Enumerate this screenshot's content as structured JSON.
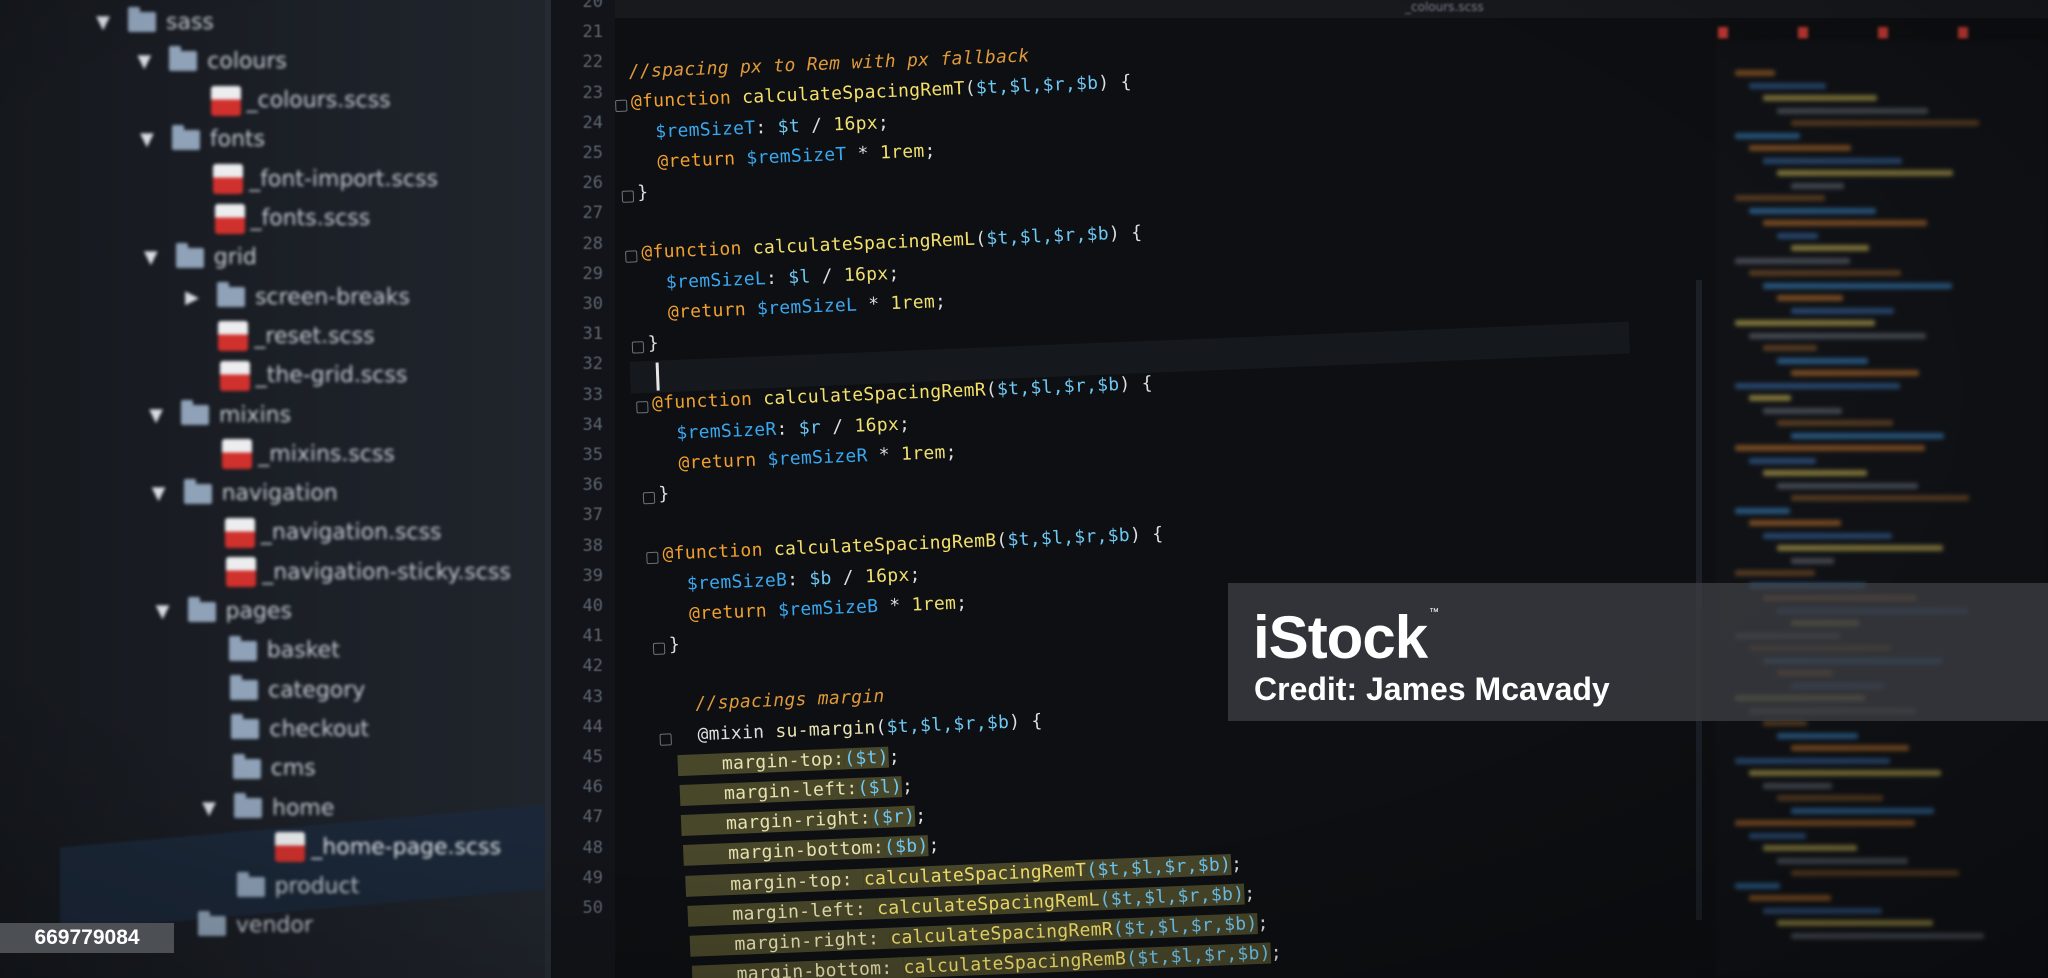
{
  "sidebar": {
    "tree": [
      {
        "kind": "folder",
        "label": "sass",
        "state": "open",
        "depth": 0
      },
      {
        "kind": "folder",
        "label": "colours",
        "state": "open",
        "depth": 1
      },
      {
        "kind": "file",
        "label": "_colours.scss",
        "depth": 2
      },
      {
        "kind": "folder",
        "label": "fonts",
        "state": "open",
        "depth": 1
      },
      {
        "kind": "file",
        "label": "_font-import.scss",
        "depth": 2
      },
      {
        "kind": "file",
        "label": "_fonts.scss",
        "depth": 2
      },
      {
        "kind": "folder",
        "label": "grid",
        "state": "open",
        "depth": 1
      },
      {
        "kind": "folder",
        "label": "screen-breaks",
        "state": "closed",
        "depth": 2
      },
      {
        "kind": "file",
        "label": "_reset.scss",
        "depth": 2
      },
      {
        "kind": "file",
        "label": "_the-grid.scss",
        "depth": 2
      },
      {
        "kind": "folder",
        "label": "mixins",
        "state": "open",
        "depth": 1
      },
      {
        "kind": "file",
        "label": "_mixins.scss",
        "depth": 2
      },
      {
        "kind": "folder",
        "label": "navigation",
        "state": "open",
        "depth": 1
      },
      {
        "kind": "file",
        "label": "_navigation.scss",
        "depth": 2
      },
      {
        "kind": "file",
        "label": "_navigation-sticky.scss",
        "depth": 2
      },
      {
        "kind": "folder",
        "label": "pages",
        "state": "open",
        "depth": 1
      },
      {
        "kind": "folder",
        "label": "basket",
        "state": "none",
        "depth": 2
      },
      {
        "kind": "folder",
        "label": "category",
        "state": "none",
        "depth": 2
      },
      {
        "kind": "folder",
        "label": "checkout",
        "state": "none",
        "depth": 2
      },
      {
        "kind": "folder",
        "label": "cms",
        "state": "none",
        "depth": 2
      },
      {
        "kind": "folder",
        "label": "home",
        "state": "open",
        "depth": 2
      },
      {
        "kind": "file",
        "label": "_home-page.scss",
        "depth": 3,
        "selected": true
      },
      {
        "kind": "folder",
        "label": "product",
        "state": "none",
        "depth": 2
      },
      {
        "kind": "folder",
        "label": "vendor",
        "state": "none",
        "depth": 1
      }
    ]
  },
  "tabs": {
    "active": "_colours.scss"
  },
  "gutter": {
    "line_numbers": [
      "20",
      "21",
      "22",
      "23",
      "24",
      "25",
      "26",
      "27",
      "28",
      "29",
      "30",
      "31",
      "32",
      "33",
      "34",
      "35",
      "36",
      "37",
      "38",
      "39",
      "40",
      "41",
      "42",
      "43",
      "44",
      "45",
      "46",
      "47",
      "48",
      "49",
      "50"
    ]
  },
  "code": {
    "lines": [
      [],
      [
        {
          "t": "//spacing px to Rem with px fallback",
          "c": "c-comment"
        }
      ],
      [
        {
          "t": "@function ",
          "c": "c-at"
        },
        {
          "t": "calculateSpacingRemT",
          "c": "c-fn"
        },
        {
          "t": "(",
          "c": "c-plain"
        },
        {
          "t": "$t,$l,$r,$b",
          "c": "c-arg"
        },
        {
          "t": ") {",
          "c": "c-plain"
        }
      ],
      [
        {
          "t": "  $remSizeT",
          "c": "c-var"
        },
        {
          "t": ": ",
          "c": "c-plain"
        },
        {
          "t": "$t",
          "c": "c-arg"
        },
        {
          "t": " / ",
          "c": "c-plain"
        },
        {
          "t": "16px",
          "c": "c-num"
        },
        {
          "t": ";",
          "c": "c-plain"
        }
      ],
      [
        {
          "t": "  @return ",
          "c": "c-at"
        },
        {
          "t": "$remSizeT",
          "c": "c-var"
        },
        {
          "t": " * ",
          "c": "c-plain"
        },
        {
          "t": "1rem",
          "c": "c-num"
        },
        {
          "t": ";",
          "c": "c-plain"
        }
      ],
      [
        {
          "t": "}",
          "c": "c-plain"
        }
      ],
      [],
      [
        {
          "t": "@function ",
          "c": "c-at"
        },
        {
          "t": "calculateSpacingRemL",
          "c": "c-fn"
        },
        {
          "t": "(",
          "c": "c-plain"
        },
        {
          "t": "$t,$l,$r,$b",
          "c": "c-arg"
        },
        {
          "t": ") {",
          "c": "c-plain"
        }
      ],
      [
        {
          "t": "  $remSizeL",
          "c": "c-var"
        },
        {
          "t": ": ",
          "c": "c-plain"
        },
        {
          "t": "$l",
          "c": "c-arg"
        },
        {
          "t": " / ",
          "c": "c-plain"
        },
        {
          "t": "16px",
          "c": "c-num"
        },
        {
          "t": ";",
          "c": "c-plain"
        }
      ],
      [
        {
          "t": "  @return ",
          "c": "c-at"
        },
        {
          "t": "$remSizeL",
          "c": "c-var"
        },
        {
          "t": " * ",
          "c": "c-plain"
        },
        {
          "t": "1rem",
          "c": "c-num"
        },
        {
          "t": ";",
          "c": "c-plain"
        }
      ],
      [
        {
          "t": "}",
          "c": "c-plain"
        }
      ],
      [],
      [
        {
          "t": "@function ",
          "c": "c-at"
        },
        {
          "t": "calculateSpacingRemR",
          "c": "c-fn"
        },
        {
          "t": "(",
          "c": "c-plain"
        },
        {
          "t": "$t,$l,$r,$b",
          "c": "c-arg"
        },
        {
          "t": ") {",
          "c": "c-plain"
        }
      ],
      [
        {
          "t": "  $remSizeR",
          "c": "c-var"
        },
        {
          "t": ": ",
          "c": "c-plain"
        },
        {
          "t": "$r",
          "c": "c-arg"
        },
        {
          "t": " / ",
          "c": "c-plain"
        },
        {
          "t": "16px",
          "c": "c-num"
        },
        {
          "t": ";",
          "c": "c-plain"
        }
      ],
      [
        {
          "t": "  @return ",
          "c": "c-at"
        },
        {
          "t": "$remSizeR",
          "c": "c-var"
        },
        {
          "t": " * ",
          "c": "c-plain"
        },
        {
          "t": "1rem",
          "c": "c-num"
        },
        {
          "t": ";",
          "c": "c-plain"
        }
      ],
      [
        {
          "t": "}",
          "c": "c-plain"
        }
      ],
      [],
      [
        {
          "t": "@function ",
          "c": "c-at"
        },
        {
          "t": "calculateSpacingRemB",
          "c": "c-fn"
        },
        {
          "t": "(",
          "c": "c-plain"
        },
        {
          "t": "$t,$l,$r,$b",
          "c": "c-arg"
        },
        {
          "t": ") {",
          "c": "c-plain"
        }
      ],
      [
        {
          "t": "  $remSizeB",
          "c": "c-var"
        },
        {
          "t": ": ",
          "c": "c-plain"
        },
        {
          "t": "$b",
          "c": "c-arg"
        },
        {
          "t": " / ",
          "c": "c-plain"
        },
        {
          "t": "16px",
          "c": "c-num"
        },
        {
          "t": ";",
          "c": "c-plain"
        }
      ],
      [
        {
          "t": "  @return ",
          "c": "c-at"
        },
        {
          "t": "$remSizeB",
          "c": "c-var"
        },
        {
          "t": " * ",
          "c": "c-plain"
        },
        {
          "t": "1rem",
          "c": "c-num"
        },
        {
          "t": ";",
          "c": "c-plain"
        }
      ],
      [
        {
          "t": "}",
          "c": "c-plain"
        }
      ],
      [],
      [
        {
          "t": "  //spacings margin",
          "c": "c-comment"
        }
      ],
      [
        {
          "t": "  @mixin ",
          "c": "c-plain"
        },
        {
          "t": "su-margin",
          "c": "c-prop"
        },
        {
          "t": "(",
          "c": "c-plain"
        },
        {
          "t": "$t,$l,$r,$b",
          "c": "c-arg"
        },
        {
          "t": ") {",
          "c": "c-plain"
        }
      ],
      [
        {
          "t": "    margin-top:",
          "c": "c-prop",
          "hl": true
        },
        {
          "t": "($t)",
          "c": "c-arg",
          "hl": true
        },
        {
          "t": ";",
          "c": "c-plain"
        }
      ],
      [
        {
          "t": "    margin-left:",
          "c": "c-prop",
          "hl": true
        },
        {
          "t": "($l)",
          "c": "c-arg",
          "hl": true
        },
        {
          "t": ";",
          "c": "c-plain"
        }
      ],
      [
        {
          "t": "    margin-right:",
          "c": "c-prop",
          "hl": true
        },
        {
          "t": "($r)",
          "c": "c-arg",
          "hl": true
        },
        {
          "t": ";",
          "c": "c-plain"
        }
      ],
      [
        {
          "t": "    margin-bottom:",
          "c": "c-prop",
          "hl": true
        },
        {
          "t": "($b)",
          "c": "c-arg",
          "hl": true
        },
        {
          "t": ";",
          "c": "c-plain"
        }
      ],
      [
        {
          "t": "    margin-top: ",
          "c": "c-prop",
          "hl": true
        },
        {
          "t": "calculateSpacingRemT",
          "c": "c-fn",
          "hl": true
        },
        {
          "t": "($t,$l,$r,$b)",
          "c": "c-arg",
          "hl": true
        },
        {
          "t": ";",
          "c": "c-plain"
        }
      ],
      [
        {
          "t": "    margin-left: ",
          "c": "c-prop",
          "hl": true
        },
        {
          "t": "calculateSpacingRemL",
          "c": "c-fn",
          "hl": true
        },
        {
          "t": "($t,$l,$r,$b)",
          "c": "c-arg",
          "hl": true
        },
        {
          "t": ";",
          "c": "c-plain"
        }
      ],
      [
        {
          "t": "    margin-right: ",
          "c": "c-prop",
          "hl": true
        },
        {
          "t": "calculateSpacingRemR",
          "c": "c-fn",
          "hl": true
        },
        {
          "t": "($t,$l,$r,$b)",
          "c": "c-arg",
          "hl": true
        },
        {
          "t": ";",
          "c": "c-plain"
        }
      ],
      [
        {
          "t": "    margin-bottom: ",
          "c": "c-prop",
          "hl": true
        },
        {
          "t": "calculateSpacingRemB",
          "c": "c-fn",
          "hl": true
        },
        {
          "t": "($t,$l,$r,$b)",
          "c": "c-arg",
          "hl": true
        },
        {
          "t": ";",
          "c": "c-plain"
        }
      ]
    ]
  },
  "watermark": {
    "logo": "iStock",
    "tm": "™",
    "credit": "Credit: James Mcavady",
    "image_id": "669779084"
  },
  "colors": {
    "comment": "#e09a3a",
    "keyword": "#f0a030",
    "function": "#f4e06a",
    "variable": "#3aa8f0",
    "selection": "#48472a",
    "file_icon": "#d0312d"
  }
}
